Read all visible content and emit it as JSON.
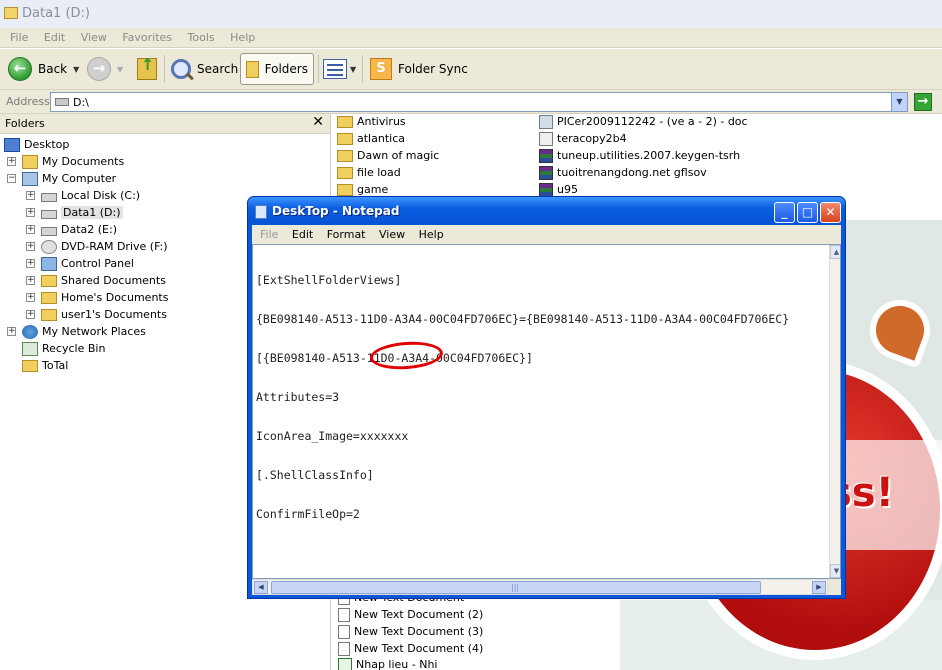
{
  "explorer": {
    "title": "Data1 (D:)",
    "menu": [
      "File",
      "Edit",
      "View",
      "Favorites",
      "Tools",
      "Help"
    ],
    "toolbar": {
      "back_label": "Back",
      "search_label": "Search",
      "folders_label": "Folders",
      "folder_sync_label": "Folder Sync"
    },
    "address": {
      "label": "Address",
      "value": "D:\\"
    },
    "folders_pane": {
      "title": "Folders",
      "close_glyph": "✕",
      "items": [
        {
          "label": "Desktop",
          "icon": "desktop-icon"
        },
        {
          "label": "My Documents",
          "icon": "my-documents-icon"
        },
        {
          "label": "My Computer",
          "icon": "computer-icon"
        },
        {
          "label": "Local Disk (C:)",
          "icon": "drive-icon"
        },
        {
          "label": "Data1 (D:)",
          "icon": "drive-icon"
        },
        {
          "label": "Data2 (E:)",
          "icon": "drive-icon"
        },
        {
          "label": "DVD-RAM Drive (F:)",
          "icon": "cd-drive-icon"
        },
        {
          "label": "Control Panel",
          "icon": "control-panel-icon"
        },
        {
          "label": "Shared Documents",
          "icon": "folder-icon"
        },
        {
          "label": "Home's Documents",
          "icon": "folder-icon"
        },
        {
          "label": "user1's Documents",
          "icon": "folder-icon"
        },
        {
          "label": "My Network Places",
          "icon": "network-icon"
        },
        {
          "label": "Recycle Bin",
          "icon": "recycle-bin-icon"
        },
        {
          "label": "ToTal",
          "icon": "folder-icon"
        }
      ]
    },
    "files_col1": [
      {
        "label": "Antivirus",
        "icon": "folder-icon"
      },
      {
        "label": "atlantica",
        "icon": "folder-icon"
      },
      {
        "label": "Dawn of magic",
        "icon": "folder-icon"
      },
      {
        "label": "file load",
        "icon": "folder-icon"
      },
      {
        "label": "game",
        "icon": "folder-icon"
      }
    ],
    "files_col2": [
      {
        "label": "PICer2009112242 - (ve a - 2) - doc",
        "icon": "image-icon"
      },
      {
        "label": "teracopy2b4",
        "icon": "installer-icon"
      },
      {
        "label": "tuneup.utilities.2007.keygen-tsrh",
        "icon": "rar-archive-icon"
      },
      {
        "label": "tuoitrenangdong.net gflsov",
        "icon": "rar-archive-icon"
      },
      {
        "label": "u95",
        "icon": "rar-archive-icon"
      }
    ],
    "files_bottom": [
      {
        "label": "New Text Document",
        "icon": "text-file-icon"
      },
      {
        "label": "New Text Document (2)",
        "icon": "text-file-icon"
      },
      {
        "label": "New Text Document (3)",
        "icon": "text-file-icon"
      },
      {
        "label": "New Text Document (4)",
        "icon": "text-file-icon"
      },
      {
        "label": "Nhap lieu - Nhi",
        "icon": "excel-file-icon"
      }
    ],
    "wallpaper_text": "ss!"
  },
  "notepad": {
    "title": "DeskTop - Notepad",
    "menu": [
      "File",
      "Edit",
      "Format",
      "View",
      "Help"
    ],
    "content": [
      "[ExtShellFolderViews]",
      "{BE098140-A513-11D0-A3A4-00C04FD706EC}={BE098140-A513-11D0-A3A4-00C04FD706EC}",
      "[{BE098140-A513-11D0-A3A4-00C04FD706EC}]",
      "Attributes=3",
      "IconArea_Image=xxxxxxx",
      "[.ShellClassInfo]",
      "ConfirmFileOp=2"
    ],
    "buttons": {
      "minimize": "_",
      "maximize": "□",
      "close": "✕"
    }
  },
  "colors": {
    "xp_blue_title": "#0a5ee0",
    "annotation_red": "#e10000",
    "chrome": "#ece9d8"
  }
}
